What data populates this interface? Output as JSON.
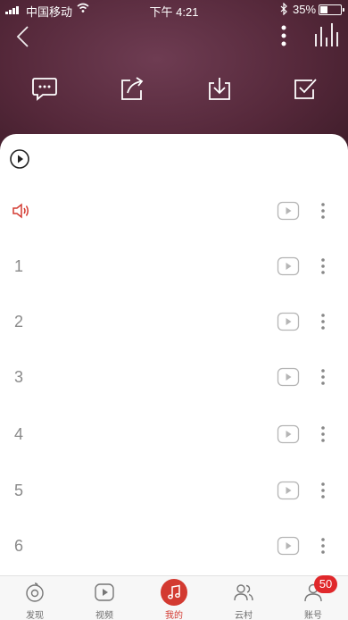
{
  "status_bar": {
    "carrier": "中国移动",
    "time": "下午 4:21",
    "battery_percent": "35%",
    "battery_level": 0.35,
    "icons": [
      "signal-icon",
      "wifi-icon",
      "bluetooth-icon",
      "battery-icon"
    ]
  },
  "header": {
    "icons": [
      "back-icon",
      "more-vertical-icon",
      "equalizer-icon"
    ],
    "actions": [
      "comment-icon",
      "share-icon",
      "download-icon",
      "multi-select-icon"
    ]
  },
  "song_list": {
    "play_all_icon": "play-circle-icon",
    "playing_indicator_icon": "speaker-icon",
    "rows": [
      {
        "number": ""
      },
      {
        "number": "1"
      },
      {
        "number": "2"
      },
      {
        "number": "3"
      },
      {
        "number": "4"
      },
      {
        "number": "5"
      },
      {
        "number": "6"
      }
    ],
    "row_icons": [
      "mv-play-icon",
      "more-dots-icon"
    ]
  },
  "tab_bar": {
    "tabs": [
      {
        "label": "发现",
        "icon": "discover-icon"
      },
      {
        "label": "视频",
        "icon": "video-icon"
      },
      {
        "label": "我的",
        "icon": "music-note-icon"
      },
      {
        "label": "云村",
        "icon": "friends-icon"
      },
      {
        "label": "账号",
        "icon": "account-icon"
      }
    ],
    "active_tab": "我的",
    "account_badge": "50"
  },
  "colors": {
    "accent": "#d33a31",
    "header_bg": "#55283a",
    "number_text": "#8a8a8a"
  }
}
